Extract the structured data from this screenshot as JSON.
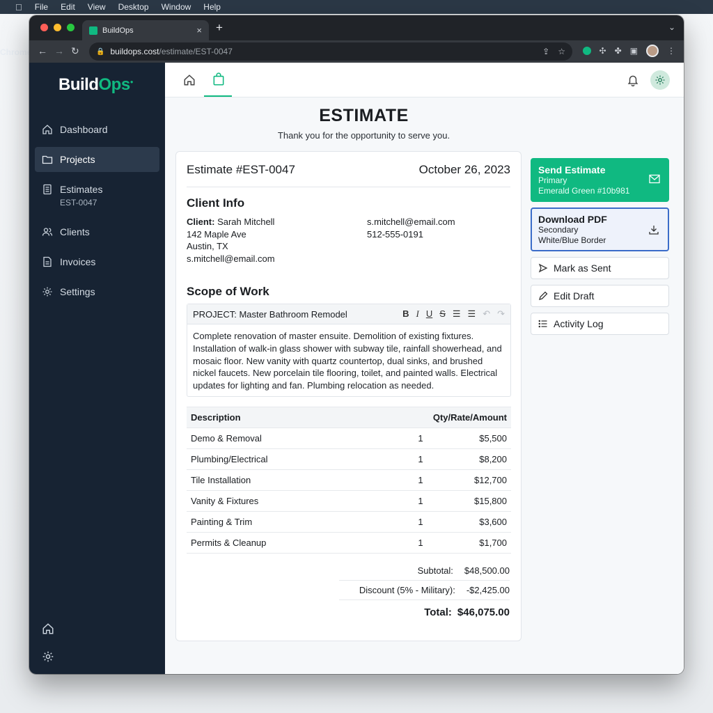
{
  "menubar": {
    "app": "Chrome",
    "items": [
      "File",
      "Edit",
      "View",
      "Desktop",
      "Window",
      "Help"
    ]
  },
  "browser": {
    "tab_title": "BuildOps",
    "url_host": "buildops.cost",
    "url_path": "estimate/EST-0047"
  },
  "sidebar": {
    "logo_build": "Build",
    "logo_ops": "Ops",
    "items": [
      {
        "label": "Dashboard",
        "icon": "home-icon"
      },
      {
        "label": "Projects",
        "icon": "folder-icon",
        "active": true
      },
      {
        "label": "Estimates",
        "sub": "EST-0047",
        "icon": "document-icon"
      },
      {
        "label": "Clients",
        "icon": "users-icon"
      },
      {
        "label": "Invoices",
        "icon": "invoice-icon"
      },
      {
        "label": "Settings",
        "icon": "gear-icon"
      }
    ]
  },
  "page": {
    "title": "ESTIMATE",
    "subtitle": "Thank you for the opportunity to serve you."
  },
  "estimate": {
    "number": "Estimate #EST-0047",
    "date": "October 26, 2023",
    "client_info_title": "Client Info",
    "client_label": "Client:",
    "client_name": "Sarah Mitchell",
    "address1": "142 Maple Ave",
    "address2": "Austin, TX",
    "email_left": "s.mitchell@email.com",
    "email_right": "s.mitchell@email.com",
    "phone": "512-555-0191",
    "scope_title": "Scope of Work",
    "project_label": "PROJECT: Master Bathroom Remodel",
    "scope_text": "Complete renovation of master ensuite. Demolition of existing fixtures. Installation of walk-in glass shower with subway tile, rainfall showerhead, and mosaic floor. New vanity with quartz countertop, dual sinks, and brushed nickel faucets. New porcelain tile flooring, toilet, and painted walls. Electrical updates for lighting and fan. Plumbing relocation as needed.",
    "table_headers": {
      "description": "Description",
      "qra": "Qty/Rate/Amount"
    },
    "items": [
      {
        "desc": "Demo & Removal",
        "qty": "1",
        "amount": "$5,500"
      },
      {
        "desc": "Plumbing/Electrical",
        "qty": "1",
        "amount": "$8,200"
      },
      {
        "desc": "Tile Installation",
        "qty": "1",
        "amount": "$12,700"
      },
      {
        "desc": "Vanity & Fixtures",
        "qty": "1",
        "amount": "$15,800"
      },
      {
        "desc": "Painting & Trim",
        "qty": "1",
        "amount": "$3,600"
      },
      {
        "desc": "Permits & Cleanup",
        "qty": "1",
        "amount": "$1,700"
      }
    ],
    "subtotal_label": "Subtotal:",
    "subtotal": "$48,500.00",
    "discount_label": "Discount (5% - Military):",
    "discount": "-$2,425.00",
    "total_label": "Total:",
    "total": "$46,075.00"
  },
  "actions": {
    "send_label": "Send Estimate",
    "send_sub1": "Primary",
    "send_sub2": "Emerald Green #10b981",
    "download_label": "Download PDF",
    "download_sub1": "Secondary",
    "download_sub2": "White/Blue Border",
    "mark_sent": "Mark as Sent",
    "edit_draft": "Edit Draft",
    "activity_log": "Activity Log"
  },
  "colors": {
    "accent": "#10b981",
    "sidebar": "#172333",
    "secondary_border": "#3b6cc9"
  }
}
